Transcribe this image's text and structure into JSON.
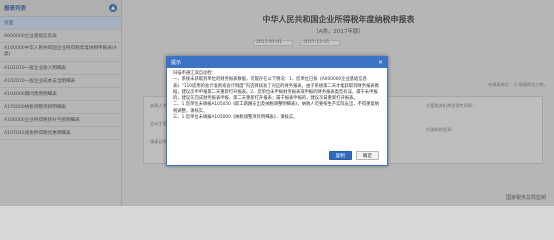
{
  "sidebar": {
    "title": "报表列表",
    "items": [
      {
        "label": "封面"
      },
      {
        "label": "A000000企业基础信息表"
      },
      {
        "label": "A100000中华人民共和国企业所得税年度纳税申报表(A类)"
      },
      {
        "label": "A101010一般企业收入明细表"
      },
      {
        "label": "A102010一般企业成本支出明细表"
      },
      {
        "label": "A104000期间费用明细表"
      },
      {
        "label": "A105000纳税调整项目明细表"
      },
      {
        "label": "A106000企业所得税弥补亏损明细表"
      },
      {
        "label": "A107040减免所得税优惠明细表"
      }
    ]
  },
  "main": {
    "title": "中华人民共和国企业所得税年度纳税申报表",
    "subtitle": "（A类，2017年版）",
    "period_from": "2017-01-01",
    "period_to": "2017-12-31",
    "right_note": "申报表单位：元 保留两位小数。",
    "labels": {
      "taxpayer_name": "纳税人名称：",
      "accountant": "会计主管：",
      "fill_date": "填表日期：",
      "fill_date_value": "2018-04-24",
      "agent": "经办人：",
      "agent_id": "经办人执业证件号码：",
      "agent_org": "代理机构签章：",
      "accept_date": "受理日期：",
      "accept_date_value": "2018-04-24",
      "authority": "主管税务机关受理专用章："
    },
    "footer": "国家税务总局监制"
  },
  "dialog": {
    "title": "提示",
    "lines": [
      "扫描申通江滨自动检：",
      "一、系统未获取到单位的财务报表数据，可能存在以下情况：1、您单位已按《A000000企业基础信息表》“110适用的会计准则或会计制度”内选择核准了对应的财务报表，由于系统第二天才能获取到财务报表数据，建议次申申报第二天重新打开报表。2、您单位未申报财务报表或申报的财务报表类型有误，属于未申报的，建议先完成财务报表申报，第二天重新打开报表；属于报表申报的，建议次日重新打开报表。",
      "二、1.您单位未填报A105050《职工薪酬支出及纳税调整明细表》，纳税人可要按生产实际支出，不得重复纳税调整，请核实。",
      "三、1.您单位未填报A105000《纳税调整项目明细表》，请核实。"
    ],
    "copy_label": "复制",
    "confirm_label": "确定"
  }
}
